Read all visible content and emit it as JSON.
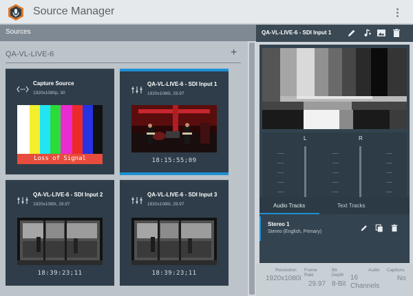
{
  "app": {
    "title": "Source Manager"
  },
  "sources_panel": {
    "header": "Sources",
    "group_name": "QA-VL-LIVE-6",
    "add_icon": "+",
    "cards": [
      {
        "name": "Capture Source",
        "format": "1920x1080p, 30",
        "icon": "signal-icon",
        "status": "Loss of Signal",
        "selected": false
      },
      {
        "name": "QA-VL-LIVE-6 - SDI Input 1",
        "format": "1920x1080i, 29.97",
        "icon": "sdi-icon",
        "timecode": "18:15:55;09",
        "selected": true
      },
      {
        "name": "QA-VL-LIVE-6 - SDI Input 2",
        "format": "1920x1080i, 29.97",
        "icon": "sdi-icon",
        "timecode": "18:39:23;11",
        "selected": false
      },
      {
        "name": "QA-VL-LIVE-6 - SDI Input 3",
        "format": "1920x1080i, 29.97",
        "icon": "sdi-icon",
        "timecode": "18:39:23;11",
        "selected": false
      }
    ]
  },
  "detail_panel": {
    "title": "QA-VL-LIVE-6 - SDI Input 1",
    "audio_meters": {
      "left_label": "L",
      "right_label": "R"
    },
    "tabs": {
      "audio": "Audio Tracks",
      "text": "Text Tracks"
    },
    "track": {
      "name": "Stereo 1",
      "desc": "Stereo (English, Primary)"
    },
    "info": {
      "resolution_label": "Resolution",
      "resolution_value": "1920x1080i",
      "frame_rate_label_1": "Frame",
      "frame_rate_label_2": "Rate",
      "frame_rate_value": "29.97",
      "bit_depth_label_1": "Bit",
      "bit_depth_label_2": "Depth",
      "bit_depth_value": "8-Bit",
      "audio_label": "Audio",
      "audio_value_1": "16",
      "audio_value_2": "Channels",
      "captions_label": "Captions",
      "captions_value": "No"
    }
  },
  "colors": {
    "accent": "#1e8fd5",
    "error": "#e74c3c",
    "card_bg": "#2e3d49"
  }
}
